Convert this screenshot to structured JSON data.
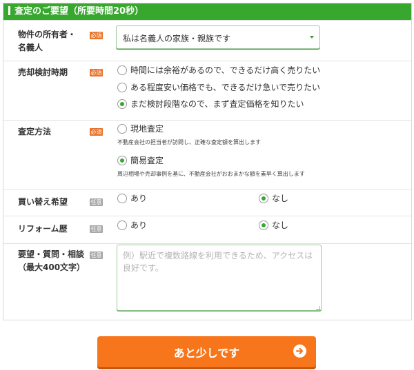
{
  "form": {
    "title": "査定のご要望（所要時間20秒）",
    "required_label": "必須",
    "optional_label": "任意"
  },
  "owner": {
    "label_line1": "物件の所有者・",
    "label_line2": "名義人",
    "selected": "私は名義人の家族・親族です"
  },
  "timing": {
    "label": "売却検討時期",
    "options": [
      {
        "label": "時間には余裕があるので、できるだけ高く売りたい",
        "checked": false
      },
      {
        "label": "ある程度安い価格でも、できるだけ急いで売りたい",
        "checked": false
      },
      {
        "label": "まだ検討段階なので、まず査定価格を知りたい",
        "checked": true
      }
    ]
  },
  "method": {
    "label": "査定方法",
    "options": [
      {
        "label": "現地査定",
        "note": "不動産会社の担当者が訪問し、正確な査定額を算出します",
        "checked": false
      },
      {
        "label": "簡易査定",
        "note": "周辺相場や売却事例を基に、不動産会社がおおまかな額を素早く算出します",
        "checked": true
      }
    ]
  },
  "replacement": {
    "label": "買い替え希望",
    "yes": "あり",
    "no": "なし",
    "selected": "no"
  },
  "reform": {
    "label": "リフォーム歴",
    "yes": "あり",
    "no": "なし",
    "selected": "no"
  },
  "request": {
    "label_line1": "要望・質問・相談",
    "label_line2": "（最大400文字）",
    "placeholder": "例）駅近で複数路線を利用できるため、アクセスは良好です。"
  },
  "submit": {
    "label": "あと少しです"
  },
  "colors": {
    "header": "#37a72e",
    "required_badge": "#e8732a",
    "optional_badge": "#a8a8a8",
    "submit": "#f8761b"
  }
}
